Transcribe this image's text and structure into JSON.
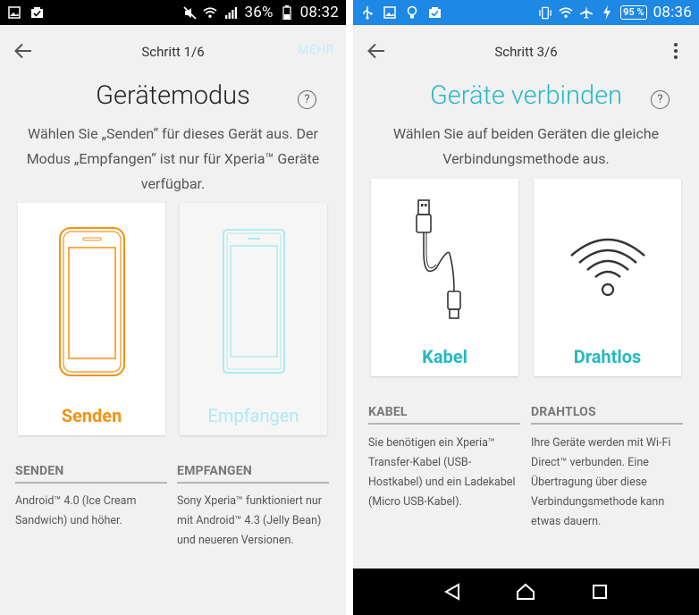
{
  "left": {
    "status": {
      "battery": "36%",
      "time": "08:32"
    },
    "appbar": {
      "step": "Schritt 1/6",
      "more": "MEHR"
    },
    "heading": "Gerätemodus",
    "help": "?",
    "description": "Wählen Sie „Senden“ für dieses Gerät aus. Der Modus „Empfangen“ ist nur für Xperia™ Geräte verfügbar.",
    "cards": [
      {
        "label": "Senden",
        "color": "#f39214"
      },
      {
        "label": "Empfangen",
        "color": "#aeeaf1"
      }
    ],
    "sections": [
      {
        "header": "SENDEN",
        "body": "Android™ 4.0 (Ice Cream Sandwich) und höher."
      },
      {
        "header": "EMPFANGEN",
        "body": "Sony Xperia™ funktioniert nur mit Android™ 4.3 (Jelly Bean) und neueren Versionen."
      }
    ]
  },
  "right": {
    "status": {
      "battery": "95 %",
      "time": "08:36"
    },
    "appbar": {
      "step": "Schritt 3/6"
    },
    "heading": "Geräte verbinden",
    "help": "?",
    "description": "Wählen Sie auf beiden Geräten die gleiche Verbindungsmethode aus.",
    "cards": [
      {
        "label": "Kabel",
        "color": "#26b8c2"
      },
      {
        "label": "Drahtlos",
        "color": "#26b8c2"
      }
    ],
    "sections": [
      {
        "header": "KABEL",
        "body": "Sie benötigen ein Xperia™ Transfer-Kabel (USB-Hostkabel) und ein Ladekabel (Micro USB-Kabel)."
      },
      {
        "header": "DRAHTLOS",
        "body": "Ihre Geräte werden mit Wi-Fi Direct™ verbunden. Eine Übertragung über diese Verbindungsmethode kann etwas dauern."
      }
    ]
  }
}
